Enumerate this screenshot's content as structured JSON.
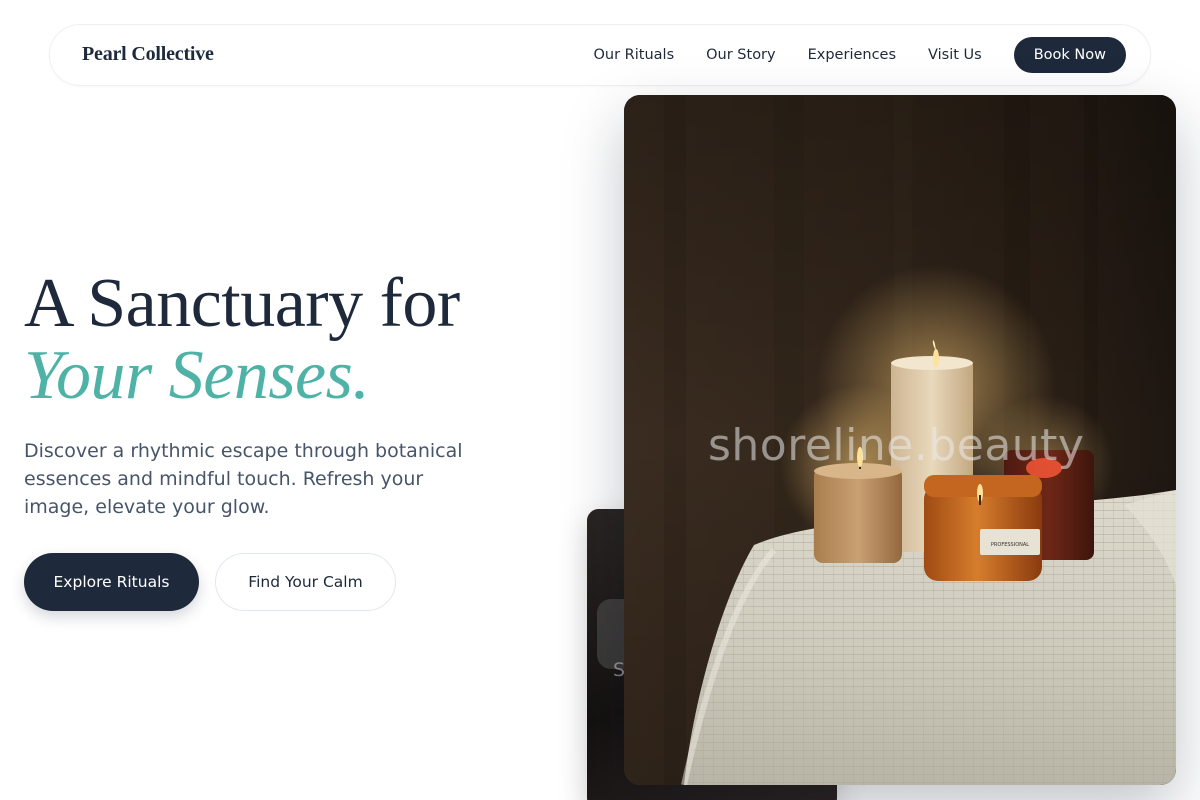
{
  "brand": "Pearl Collective",
  "nav": {
    "links": [
      "Our Rituals",
      "Our Story",
      "Experiences",
      "Visit Us"
    ],
    "cta": "Book Now"
  },
  "hero": {
    "title_line1": "A Sanctuary for",
    "title_line2": "Your Senses.",
    "subtitle": "Discover a rhythmic escape through botanical essences and mindful touch. Refresh your image, elevate your glow.",
    "primary_button": "Explore Rituals",
    "secondary_button": "Find Your Calm"
  },
  "images": {
    "main_watermark": "shoreline.beauty",
    "back_watermark": "S",
    "jar_label": "PROFESSIONAL"
  },
  "colors": {
    "navy": "#1e293b",
    "teal_accent": "#4fb2a6",
    "body_text": "#475569"
  }
}
